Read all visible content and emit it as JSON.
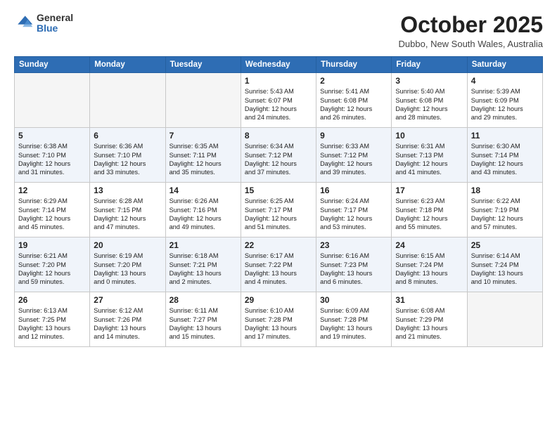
{
  "header": {
    "logo_general": "General",
    "logo_blue": "Blue",
    "month_title": "October 2025",
    "location": "Dubbo, New South Wales, Australia"
  },
  "days_of_week": [
    "Sunday",
    "Monday",
    "Tuesday",
    "Wednesday",
    "Thursday",
    "Friday",
    "Saturday"
  ],
  "weeks": [
    [
      {
        "day": "",
        "info": ""
      },
      {
        "day": "",
        "info": ""
      },
      {
        "day": "",
        "info": ""
      },
      {
        "day": "1",
        "info": "Sunrise: 5:43 AM\nSunset: 6:07 PM\nDaylight: 12 hours\nand 24 minutes."
      },
      {
        "day": "2",
        "info": "Sunrise: 5:41 AM\nSunset: 6:08 PM\nDaylight: 12 hours\nand 26 minutes."
      },
      {
        "day": "3",
        "info": "Sunrise: 5:40 AM\nSunset: 6:08 PM\nDaylight: 12 hours\nand 28 minutes."
      },
      {
        "day": "4",
        "info": "Sunrise: 5:39 AM\nSunset: 6:09 PM\nDaylight: 12 hours\nand 29 minutes."
      }
    ],
    [
      {
        "day": "5",
        "info": "Sunrise: 6:38 AM\nSunset: 7:10 PM\nDaylight: 12 hours\nand 31 minutes."
      },
      {
        "day": "6",
        "info": "Sunrise: 6:36 AM\nSunset: 7:10 PM\nDaylight: 12 hours\nand 33 minutes."
      },
      {
        "day": "7",
        "info": "Sunrise: 6:35 AM\nSunset: 7:11 PM\nDaylight: 12 hours\nand 35 minutes."
      },
      {
        "day": "8",
        "info": "Sunrise: 6:34 AM\nSunset: 7:12 PM\nDaylight: 12 hours\nand 37 minutes."
      },
      {
        "day": "9",
        "info": "Sunrise: 6:33 AM\nSunset: 7:12 PM\nDaylight: 12 hours\nand 39 minutes."
      },
      {
        "day": "10",
        "info": "Sunrise: 6:31 AM\nSunset: 7:13 PM\nDaylight: 12 hours\nand 41 minutes."
      },
      {
        "day": "11",
        "info": "Sunrise: 6:30 AM\nSunset: 7:14 PM\nDaylight: 12 hours\nand 43 minutes."
      }
    ],
    [
      {
        "day": "12",
        "info": "Sunrise: 6:29 AM\nSunset: 7:14 PM\nDaylight: 12 hours\nand 45 minutes."
      },
      {
        "day": "13",
        "info": "Sunrise: 6:28 AM\nSunset: 7:15 PM\nDaylight: 12 hours\nand 47 minutes."
      },
      {
        "day": "14",
        "info": "Sunrise: 6:26 AM\nSunset: 7:16 PM\nDaylight: 12 hours\nand 49 minutes."
      },
      {
        "day": "15",
        "info": "Sunrise: 6:25 AM\nSunset: 7:17 PM\nDaylight: 12 hours\nand 51 minutes."
      },
      {
        "day": "16",
        "info": "Sunrise: 6:24 AM\nSunset: 7:17 PM\nDaylight: 12 hours\nand 53 minutes."
      },
      {
        "day": "17",
        "info": "Sunrise: 6:23 AM\nSunset: 7:18 PM\nDaylight: 12 hours\nand 55 minutes."
      },
      {
        "day": "18",
        "info": "Sunrise: 6:22 AM\nSunset: 7:19 PM\nDaylight: 12 hours\nand 57 minutes."
      }
    ],
    [
      {
        "day": "19",
        "info": "Sunrise: 6:21 AM\nSunset: 7:20 PM\nDaylight: 12 hours\nand 59 minutes."
      },
      {
        "day": "20",
        "info": "Sunrise: 6:19 AM\nSunset: 7:20 PM\nDaylight: 13 hours\nand 0 minutes."
      },
      {
        "day": "21",
        "info": "Sunrise: 6:18 AM\nSunset: 7:21 PM\nDaylight: 13 hours\nand 2 minutes."
      },
      {
        "day": "22",
        "info": "Sunrise: 6:17 AM\nSunset: 7:22 PM\nDaylight: 13 hours\nand 4 minutes."
      },
      {
        "day": "23",
        "info": "Sunrise: 6:16 AM\nSunset: 7:23 PM\nDaylight: 13 hours\nand 6 minutes."
      },
      {
        "day": "24",
        "info": "Sunrise: 6:15 AM\nSunset: 7:24 PM\nDaylight: 13 hours\nand 8 minutes."
      },
      {
        "day": "25",
        "info": "Sunrise: 6:14 AM\nSunset: 7:24 PM\nDaylight: 13 hours\nand 10 minutes."
      }
    ],
    [
      {
        "day": "26",
        "info": "Sunrise: 6:13 AM\nSunset: 7:25 PM\nDaylight: 13 hours\nand 12 minutes."
      },
      {
        "day": "27",
        "info": "Sunrise: 6:12 AM\nSunset: 7:26 PM\nDaylight: 13 hours\nand 14 minutes."
      },
      {
        "day": "28",
        "info": "Sunrise: 6:11 AM\nSunset: 7:27 PM\nDaylight: 13 hours\nand 15 minutes."
      },
      {
        "day": "29",
        "info": "Sunrise: 6:10 AM\nSunset: 7:28 PM\nDaylight: 13 hours\nand 17 minutes."
      },
      {
        "day": "30",
        "info": "Sunrise: 6:09 AM\nSunset: 7:28 PM\nDaylight: 13 hours\nand 19 minutes."
      },
      {
        "day": "31",
        "info": "Sunrise: 6:08 AM\nSunset: 7:29 PM\nDaylight: 13 hours\nand 21 minutes."
      },
      {
        "day": "",
        "info": ""
      }
    ]
  ]
}
